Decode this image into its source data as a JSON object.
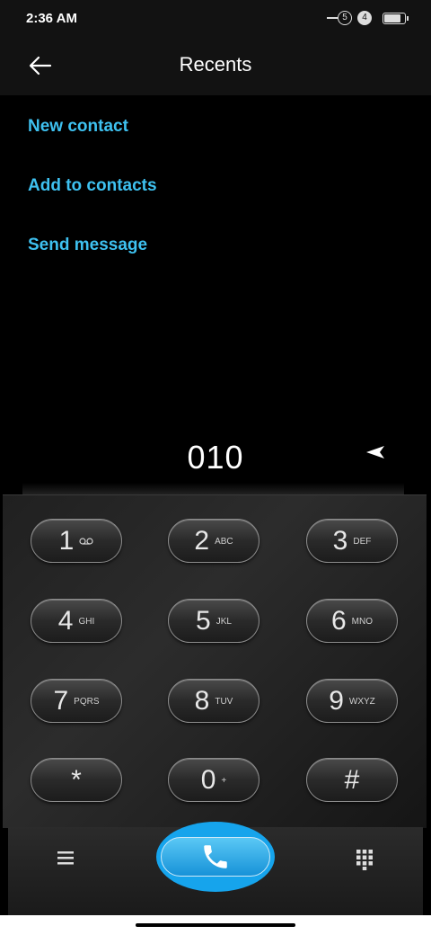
{
  "status_bar": {
    "time": "2:36 AM",
    "sim1": "5",
    "sim2": "4",
    "battery_level": 0.9
  },
  "header": {
    "title": "Recents"
  },
  "actions": [
    {
      "label": "New contact"
    },
    {
      "label": "Add to contacts"
    },
    {
      "label": "Send message"
    }
  ],
  "dialer": {
    "number": "010"
  },
  "keypad": [
    {
      "digit": "1",
      "letters": "",
      "icon": "voicemail-icon"
    },
    {
      "digit": "2",
      "letters": "ABC"
    },
    {
      "digit": "3",
      "letters": "DEF"
    },
    {
      "digit": "4",
      "letters": "GHI"
    },
    {
      "digit": "5",
      "letters": "JKL"
    },
    {
      "digit": "6",
      "letters": "MNO"
    },
    {
      "digit": "7",
      "letters": "PQRS"
    },
    {
      "digit": "8",
      "letters": "TUV"
    },
    {
      "digit": "9",
      "letters": "WXYZ"
    },
    {
      "digit": "*",
      "letters": ""
    },
    {
      "digit": "0",
      "letters": "+"
    },
    {
      "digit": "#",
      "letters": ""
    }
  ],
  "bottom_bar": {
    "left_icon": "menu-icon",
    "center_icon": "phone-icon",
    "right_icon": "dialpad-icon"
  },
  "colors": {
    "accent": "#3ec1f0",
    "call_button": "#16a4ec"
  }
}
